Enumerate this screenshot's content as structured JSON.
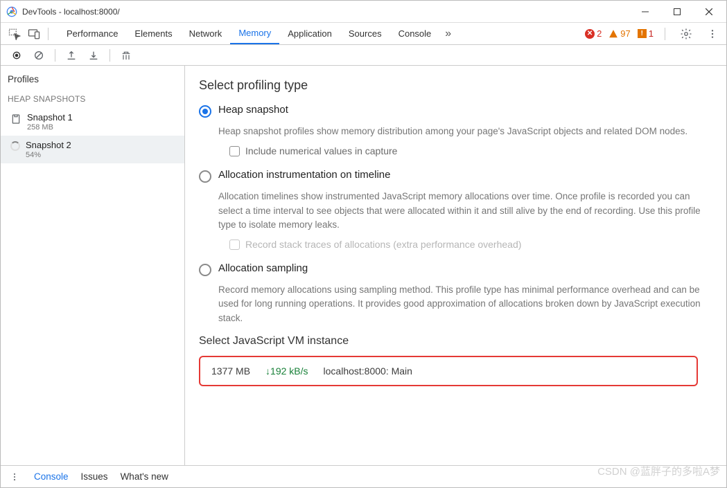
{
  "window": {
    "title": "DevTools - localhost:8000/"
  },
  "tabs": {
    "items": [
      "Performance",
      "Elements",
      "Network",
      "Memory",
      "Application",
      "Sources",
      "Console"
    ],
    "active_index": 3
  },
  "status": {
    "errors": "2",
    "warnings": "97",
    "issues": "1"
  },
  "sidebar": {
    "header": "Profiles",
    "category": "HEAP SNAPSHOTS",
    "snapshots": [
      {
        "name": "Snapshot 1",
        "meta": "258 MB",
        "loading": false
      },
      {
        "name": "Snapshot 2",
        "meta": "54%",
        "loading": true
      }
    ],
    "selected_index": 1
  },
  "profiling": {
    "heading": "Select profiling type",
    "options": [
      {
        "label": "Heap snapshot",
        "checked": true,
        "desc": "Heap snapshot profiles show memory distribution among your page's JavaScript objects and related DOM nodes.",
        "sub": {
          "label": "Include numerical values in capture",
          "disabled": false
        }
      },
      {
        "label": "Allocation instrumentation on timeline",
        "checked": false,
        "desc": "Allocation timelines show instrumented JavaScript memory allocations over time. Once profile is recorded you can select a time interval to see objects that were allocated within it and still alive by the end of recording. Use this profile type to isolate memory leaks.",
        "sub": {
          "label": "Record stack traces of allocations (extra performance overhead)",
          "disabled": true
        }
      },
      {
        "label": "Allocation sampling",
        "checked": false,
        "desc": "Record memory allocations using sampling method. This profile type has minimal performance overhead and can be used for long running operations. It provides good approximation of allocations broken down by JavaScript execution stack."
      }
    ]
  },
  "vm": {
    "heading": "Select JavaScript VM instance",
    "size": "1377 MB",
    "rate": "192 kB/s",
    "target": "localhost:8000: Main"
  },
  "footer": {
    "items": [
      "Console",
      "Issues",
      "What's new"
    ],
    "active_index": 0
  },
  "watermark": "CSDN @蓝胖子的多啦A梦"
}
